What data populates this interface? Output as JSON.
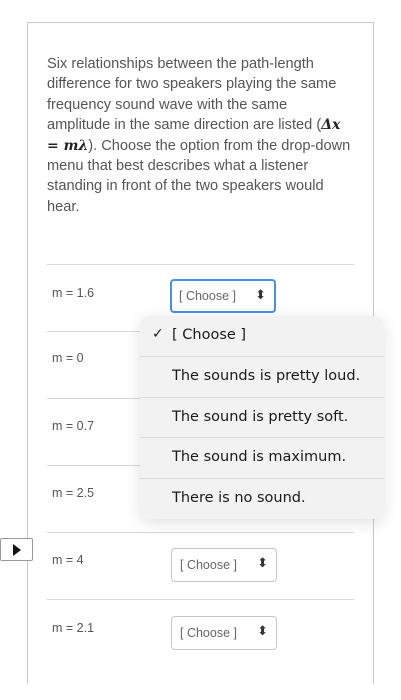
{
  "prompt": {
    "text_before": "Six relationships between the path-length difference for two speakers playing the same frequency sound wave with the same amplitude in the same direction are listed (",
    "math": "Δx = mλ",
    "text_after": "). Choose the option from the drop-down menu that best describes what a listener standing in front of the two speakers would hear."
  },
  "rows": [
    {
      "label": "m = 1.6",
      "selected": "[ Choose ]"
    },
    {
      "label": "m = 0",
      "selected": "[ Choose ]"
    },
    {
      "label": "m = 0.7",
      "selected": "[ Choose ]"
    },
    {
      "label": "m = 2.5",
      "selected": "[ Choose ]"
    },
    {
      "label": "m = 4",
      "selected": "[ Choose ]"
    },
    {
      "label": "m = 2.1",
      "selected": "[ Choose ]"
    }
  ],
  "dropdown": {
    "checkmark": "✓",
    "options": [
      "[ Choose ]",
      "The sounds is pretty loud.",
      "The sound is pretty soft.",
      "The sound is maximum.",
      "There is no sound."
    ]
  },
  "icons": {
    "select_chevron": "up-down-chevron",
    "play": "play-icon"
  },
  "colors": {
    "focus_ring": "#4a90e2",
    "dropdown_bg": "#f2f2f2"
  }
}
